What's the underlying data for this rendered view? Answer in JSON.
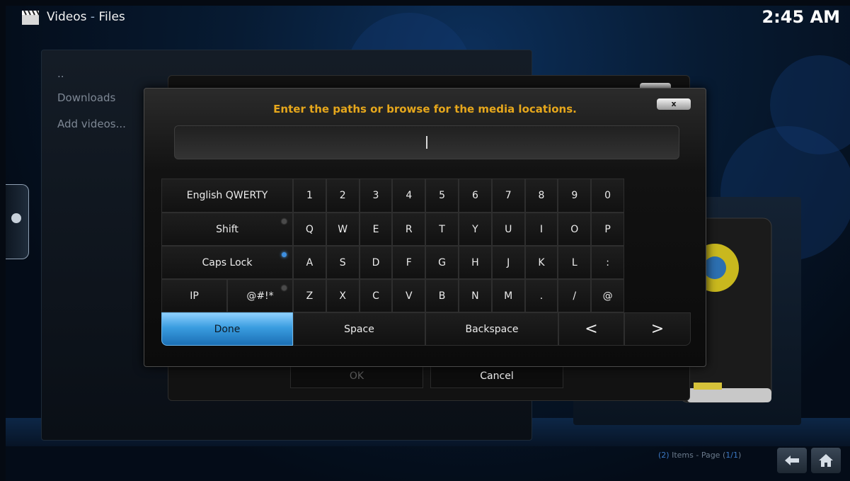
{
  "header": {
    "section": "Videos",
    "separator": "-",
    "subsection": "Files",
    "clock": "2:45 AM"
  },
  "file_list": {
    "items": [
      {
        "label": ".."
      },
      {
        "label": "Downloads"
      },
      {
        "label": "Add videos..."
      }
    ]
  },
  "source_dialog": {
    "ok_label": "OK",
    "cancel_label": "Cancel"
  },
  "keyboard": {
    "heading": "Enter the paths or browse for the media locations.",
    "close_label": "x",
    "input_value": "",
    "layout_label": "English QWERTY",
    "shift_label": "Shift",
    "caps_label": "Caps Lock",
    "ip_label": "IP",
    "symbols_label": "@#!*",
    "number_row": [
      "1",
      "2",
      "3",
      "4",
      "5",
      "6",
      "7",
      "8",
      "9",
      "0"
    ],
    "row_q": [
      "Q",
      "W",
      "E",
      "R",
      "T",
      "Y",
      "U",
      "I",
      "O",
      "P"
    ],
    "row_a": [
      "A",
      "S",
      "D",
      "F",
      "G",
      "H",
      "J",
      "K",
      "L",
      ":"
    ],
    "row_z": [
      "Z",
      "X",
      "C",
      "V",
      "B",
      "N",
      "M",
      ".",
      "/",
      "@"
    ],
    "done_label": "Done",
    "space_label": "Space",
    "backspace_label": "Backspace",
    "left_label": "<",
    "right_label": ">",
    "caps_lock_on": true,
    "shift_on": false,
    "symbols_on": false
  },
  "footer": {
    "count": "(2)",
    "items_text": " Items - Page (",
    "page": "1/1",
    "close_paren": ")"
  },
  "colors": {
    "heading": "#e6a71c",
    "accent": "#3a9de0"
  }
}
